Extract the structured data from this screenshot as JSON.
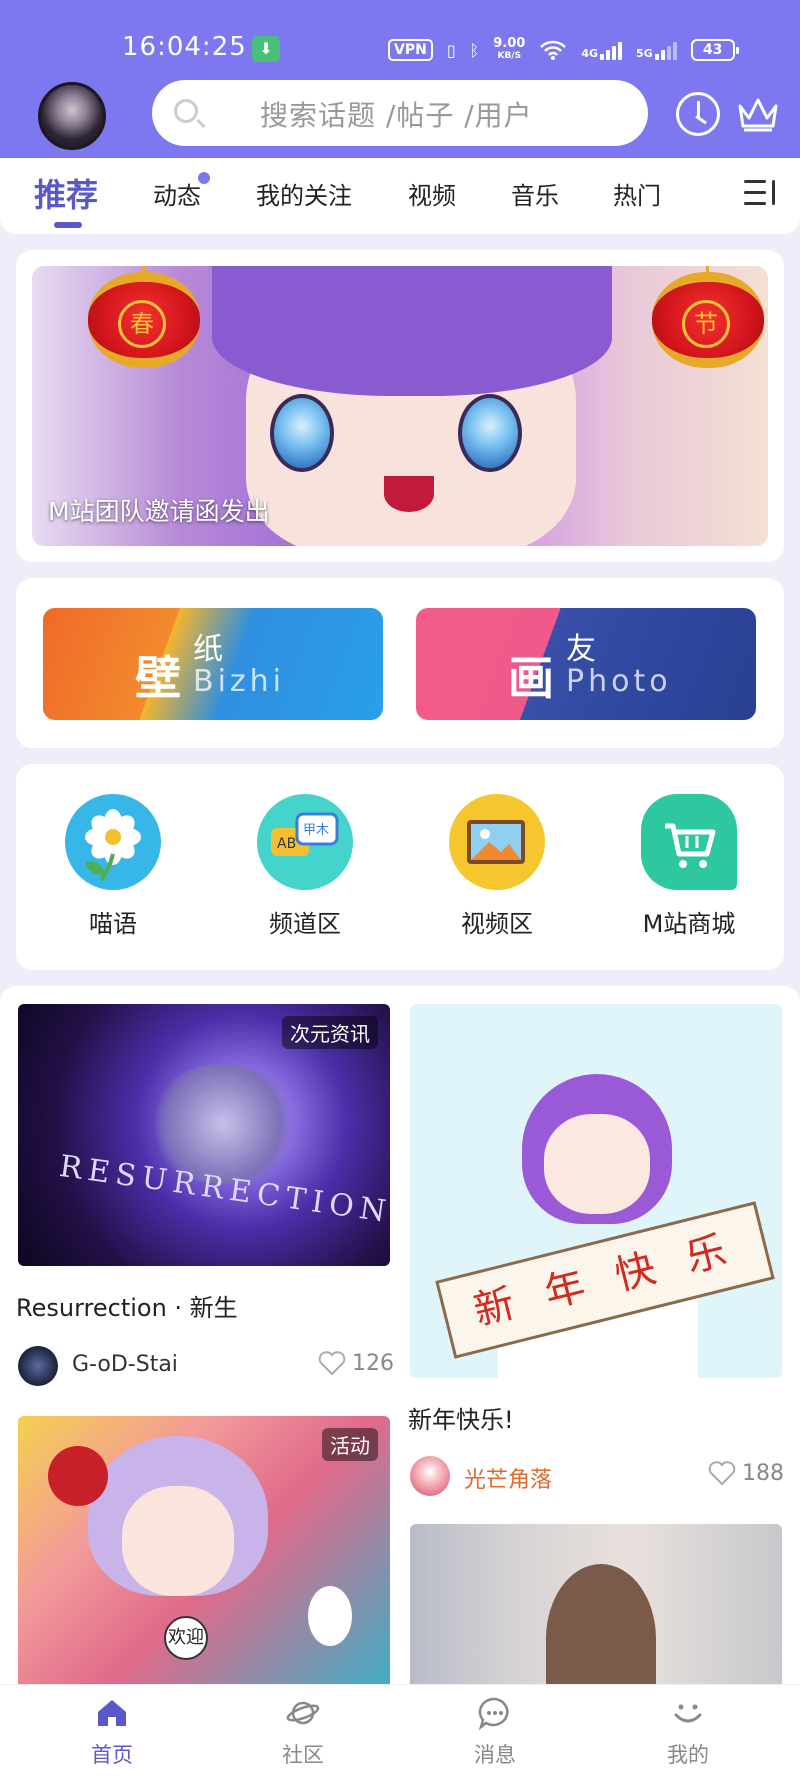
{
  "status_bar": {
    "time": "16:04:25",
    "vpn": "VPN",
    "speed_value": "9.00",
    "speed_unit": "KB/S",
    "net1": "4G",
    "net2": "5G",
    "battery": "43"
  },
  "header": {
    "search_placeholder": "搜索话题 /帖子 /用户"
  },
  "tabs": [
    {
      "label": "推荐",
      "active": true
    },
    {
      "label": "动态",
      "badge": true
    },
    {
      "label": "我的关注"
    },
    {
      "label": "视频"
    },
    {
      "label": "音乐"
    },
    {
      "label": "热门"
    }
  ],
  "banner": {
    "caption": "M站团队邀请函发出",
    "lantern_left": "春",
    "lantern_right": "节"
  },
  "features": [
    {
      "big": "壁",
      "small": "纸",
      "en": "Bizhi"
    },
    {
      "big": "画",
      "small": "友",
      "en": "Photo"
    }
  ],
  "categories": [
    {
      "label": "喵语",
      "icon": "flower-icon"
    },
    {
      "label": "频道区",
      "icon": "chat-bubbles-icon"
    },
    {
      "label": "视频区",
      "icon": "picture-icon"
    },
    {
      "label": "M站商城",
      "icon": "cart-icon"
    }
  ],
  "posts": [
    {
      "tag": "次元资讯",
      "title": "Resurrection · 新生",
      "author": "G-oD-Stai",
      "likes": "126",
      "image_text": "RESURRECTION"
    },
    {
      "title": "新年快乐!",
      "author": "光芒角落",
      "author_color": "#e06a2c",
      "likes": "188",
      "scroll_text": "新 年 快 乐"
    },
    {
      "tag": "活动",
      "badge_text": "欢迎"
    }
  ],
  "bottom_nav": [
    {
      "label": "首页",
      "icon": "home-icon",
      "active": true
    },
    {
      "label": "社区",
      "icon": "planet-icon"
    },
    {
      "label": "消息",
      "icon": "message-icon"
    },
    {
      "label": "我的",
      "icon": "smile-icon"
    }
  ],
  "colors": {
    "primary": "#7d78f0",
    "accent": "#5b58c8"
  }
}
